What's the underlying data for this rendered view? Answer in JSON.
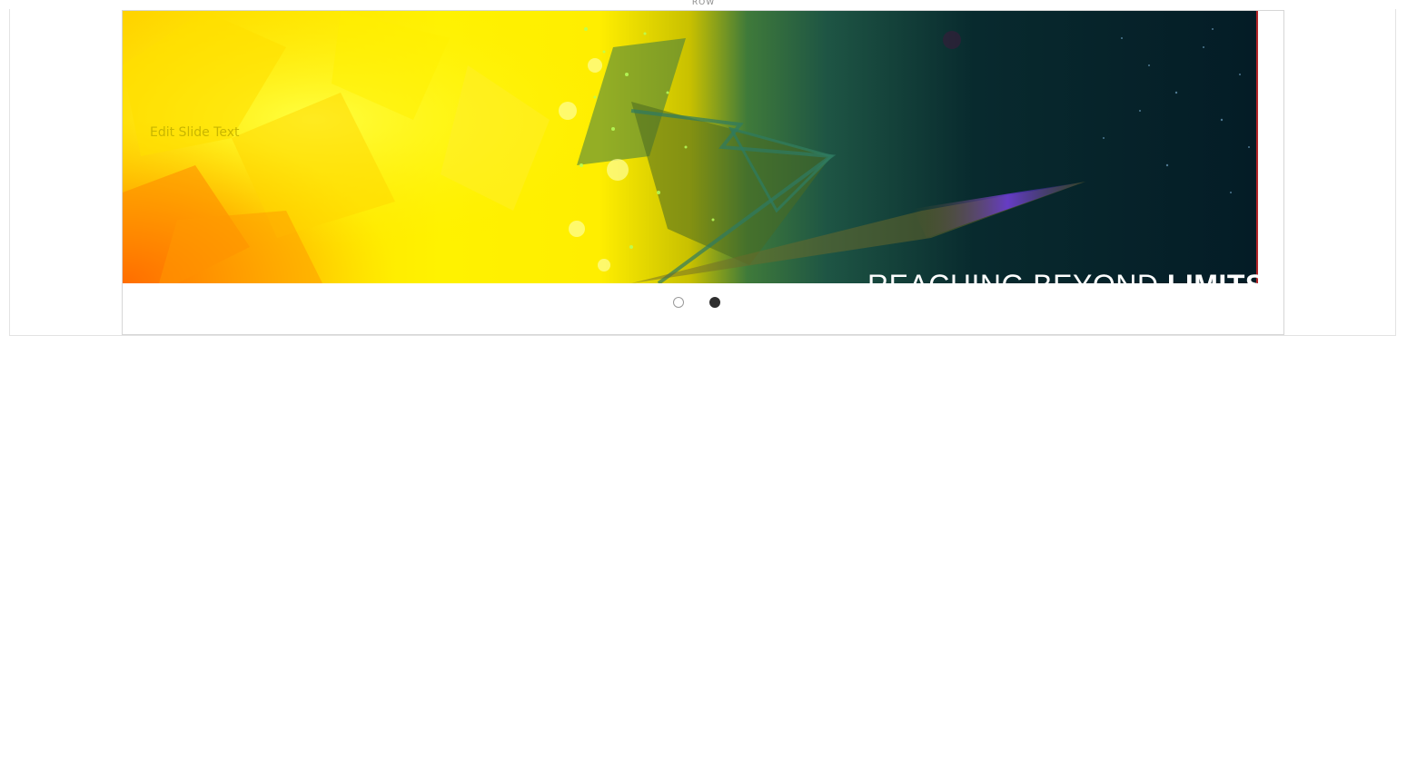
{
  "row": {
    "label": "ROW"
  },
  "slider": {
    "slide_text": "Edit Slide Text",
    "caption_regular": "REACHING BEYOND",
    "caption_bold": "LIMITS",
    "total_slides": 2,
    "active_slide": 2,
    "colors": {
      "sun_yellow": "#ffee00",
      "sun_orange": "#ff8a00",
      "space_dark": "#04202a",
      "teal": "#1d5f4e",
      "comet_purple": "#5b2fd0",
      "slide_text_color": "#c9b600"
    }
  },
  "pagination": {
    "dots": [
      {
        "label": "slide-1",
        "state": "inactive"
      },
      {
        "label": "slide-2",
        "state": "active"
      }
    ]
  }
}
